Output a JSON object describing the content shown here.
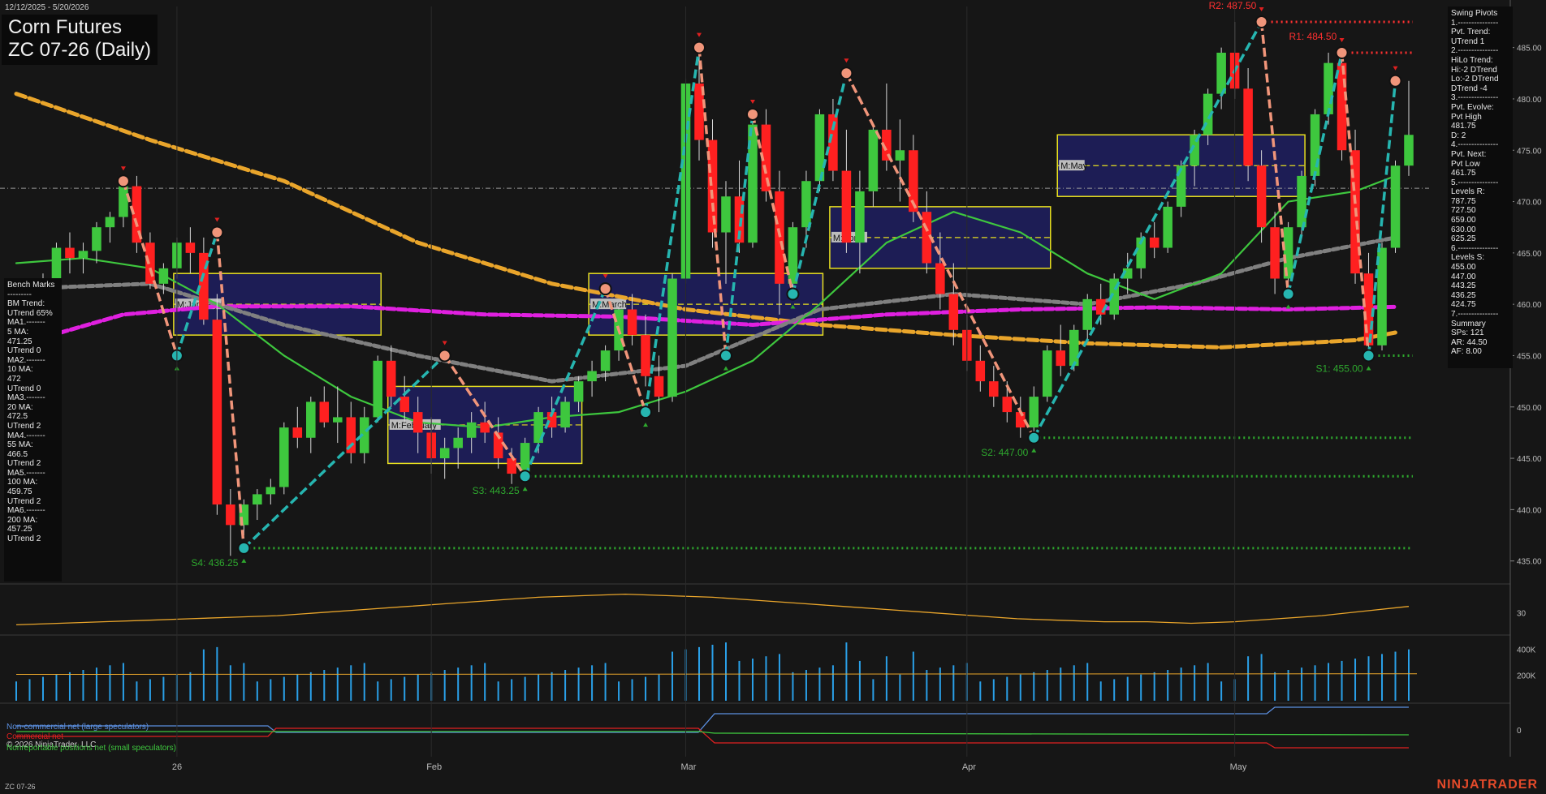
{
  "header": {
    "date_range": "12/12/2025 - 5/20/2026",
    "title_line1": "Corn Futures",
    "title_line2": "ZC 07-26 (Daily)"
  },
  "swing_panel_text": "Swing Pivots\n1.---------------\nPvt. Trend:\nUTrend 1\n2.---------------\nHiLo Trend:\nHi:-2 DTrend\nLo:-2 DTrend\nDTrend -4\n3.---------------\nPvt. Evolve:\nPvt High\n481.75\nD: 2\n4.---------------\nPvt. Next:\nPvt Low\n461.75\n5.---------------\nLevels R:\n787.75\n727.50\n659.00\n630.00\n625.25\n6.---------------\nLevels S:\n455.00\n447.00\n443.25\n436.25\n424.75\n7.---------------\nSummary\nSPs: 121\nAR: 44.50\nAF: 8.00",
  "bench_panel_text": "Bench Marks\n---------\nBM Trend:\nUTrend 65%\nMA1.-------\n5 MA:\n471.25\nUTrend 0\nMA2.-------\n10 MA:\n472\nUTrend 0\nMA3.-------\n20 MA:\n472.5\nUTrend 2\nMA4.-------\n55 MA:\n466.5\nUTrend 2\nMA5.-------\n100 MA:\n459.75\nUTrend 2\nMA6.-------\n200 MA:\n457.25\nUTrend 2",
  "cot_legend": {
    "noncommercial": "Non-commercial net (large speculators)",
    "commercial": "Commercial net",
    "copyright": "© 2026 NinjaTrader, LLC",
    "nonreportable": "Nonreportable positions net (small speculators)"
  },
  "footer": {
    "symbol": "ZC 07-26",
    "brand": "NINJATRADER"
  },
  "chart_data": {
    "type": "candlestick",
    "y_range": [
      433,
      489
    ],
    "y_ticks": [
      "435.00",
      "440.00",
      "445.00",
      "450.00",
      "455.00",
      "460.00",
      "465.00",
      "470.00",
      "475.00",
      "480.00",
      "485.00"
    ],
    "x_labels": [
      {
        "i": 12,
        "label": "26"
      },
      {
        "i": 31,
        "label": "Feb"
      },
      {
        "i": 50,
        "label": "Mar"
      },
      {
        "i": 71,
        "label": "Apr"
      },
      {
        "i": 91,
        "label": "May"
      }
    ],
    "candles": [
      [
        460.5,
        461,
        459,
        460.2
      ],
      [
        460.2,
        461,
        459.5,
        460.8
      ],
      [
        460.8,
        463,
        459.5,
        462
      ],
      [
        462,
        466,
        461,
        465.5
      ],
      [
        465.5,
        467,
        463,
        464.5
      ],
      [
        464.5,
        466,
        463,
        465.2
      ],
      [
        465.2,
        468,
        464,
        467.5
      ],
      [
        467.5,
        469,
        466,
        468.5
      ],
      [
        468.5,
        472,
        467.5,
        471.5
      ],
      [
        471.5,
        472.5,
        465,
        466
      ],
      [
        466,
        467,
        461.5,
        462
      ],
      [
        462,
        464,
        461,
        463.5
      ],
      [
        463.5,
        466.5,
        462.5,
        466
      ],
      [
        466,
        467.5,
        463,
        465
      ],
      [
        465,
        466.5,
        458,
        458.5
      ],
      [
        458.5,
        461,
        439.5,
        440.5
      ],
      [
        440.5,
        442,
        435.5,
        438.5
      ],
      [
        438.5,
        441,
        437.5,
        440.5
      ],
      [
        440.5,
        442,
        439,
        441.5
      ],
      [
        441.5,
        443,
        440.5,
        442.2
      ],
      [
        442.2,
        448.5,
        441.5,
        448
      ],
      [
        448,
        450,
        446,
        447
      ],
      [
        447,
        451,
        445.5,
        450.5
      ],
      [
        450.5,
        452,
        448,
        448.5
      ],
      [
        448.5,
        452,
        446.5,
        449
      ],
      [
        449,
        450.5,
        444.5,
        445.5
      ],
      [
        445.5,
        450,
        444.5,
        449
      ],
      [
        449,
        455,
        448.5,
        454.5
      ],
      [
        454.5,
        456,
        450,
        451
      ],
      [
        451,
        453,
        448.5,
        449.5
      ],
      [
        449.5,
        451,
        445.5,
        447.5
      ],
      [
        447.5,
        449,
        443.5,
        445
      ],
      [
        445,
        447,
        443,
        446
      ],
      [
        446,
        448,
        444,
        447
      ],
      [
        447,
        449.5,
        445.5,
        448.5
      ],
      [
        448.5,
        450.5,
        446.5,
        447.5
      ],
      [
        447.5,
        449,
        444,
        445
      ],
      [
        445,
        446,
        442.5,
        443.5
      ],
      [
        443.5,
        447,
        443,
        446.5
      ],
      [
        446.5,
        450,
        445.5,
        449.5
      ],
      [
        449.5,
        451,
        447,
        448
      ],
      [
        448,
        451,
        447.5,
        450.5
      ],
      [
        450.5,
        453,
        449.5,
        452.5
      ],
      [
        452.5,
        454.5,
        451,
        453.5
      ],
      [
        453.5,
        456,
        452.5,
        455.5
      ],
      [
        455.5,
        460,
        454.5,
        459.5
      ],
      [
        459.5,
        461,
        456,
        457
      ],
      [
        457,
        459,
        452,
        453
      ],
      [
        453,
        455,
        449.5,
        451
      ],
      [
        451,
        463,
        450.5,
        462.5
      ],
      [
        462.5,
        482,
        462,
        481.5
      ],
      [
        481.5,
        484.5,
        474,
        476
      ],
      [
        476,
        478,
        465.5,
        467
      ],
      [
        467,
        472,
        462,
        470.5
      ],
      [
        470.5,
        474,
        465,
        466
      ],
      [
        466,
        478.5,
        465.5,
        477.5
      ],
      [
        477.5,
        479,
        470,
        471
      ],
      [
        471,
        473,
        459,
        462
      ],
      [
        462,
        468,
        460.5,
        467.5
      ],
      [
        467.5,
        473,
        465.5,
        472
      ],
      [
        472,
        479,
        471,
        478.5
      ],
      [
        478.5,
        480,
        472,
        473
      ],
      [
        473,
        477,
        465,
        466
      ],
      [
        466,
        473,
        463,
        471
      ],
      [
        471,
        477.5,
        469.5,
        477
      ],
      [
        477,
        481.5,
        473,
        474
      ],
      [
        474,
        478,
        470,
        475
      ],
      [
        475,
        476.5,
        468,
        469
      ],
      [
        469,
        471,
        463,
        464
      ],
      [
        464,
        467,
        459.5,
        461
      ],
      [
        461,
        464,
        456,
        457.5
      ],
      [
        457.5,
        459,
        453.5,
        454.5
      ],
      [
        454.5,
        456,
        451.5,
        452.5
      ],
      [
        452.5,
        454,
        450,
        451
      ],
      [
        451,
        452.5,
        448.5,
        449.5
      ],
      [
        449.5,
        451,
        447,
        448
      ],
      [
        448,
        452,
        447.5,
        451
      ],
      [
        451,
        456,
        450.5,
        455.5
      ],
      [
        455.5,
        458,
        453,
        454
      ],
      [
        454,
        458,
        453.5,
        457.5
      ],
      [
        457.5,
        461,
        456.5,
        460.5
      ],
      [
        460.5,
        462,
        458,
        459
      ],
      [
        459,
        463,
        458.5,
        462.5
      ],
      [
        462.5,
        465,
        461,
        463.5
      ],
      [
        463.5,
        467,
        462.5,
        466.5
      ],
      [
        466.5,
        468,
        464.5,
        465.5
      ],
      [
        465.5,
        470,
        465,
        469.5
      ],
      [
        469.5,
        474,
        468.5,
        473.5
      ],
      [
        473.5,
        477,
        471.5,
        476.5
      ],
      [
        476.5,
        481,
        475.5,
        480.5
      ],
      [
        480.5,
        485,
        479,
        484.5
      ],
      [
        484.5,
        487.5,
        480,
        481
      ],
      [
        481,
        483,
        472,
        473.5
      ],
      [
        473.5,
        475,
        466,
        467.5
      ],
      [
        467.5,
        469,
        461,
        462.5
      ],
      [
        462.5,
        468,
        462,
        467.5
      ],
      [
        467.5,
        473,
        466.5,
        472.5
      ],
      [
        472.5,
        479,
        471.5,
        478.5
      ],
      [
        478.5,
        484.5,
        477.5,
        483.5
      ],
      [
        483.5,
        484,
        474,
        475
      ],
      [
        475,
        477,
        462,
        463
      ],
      [
        463,
        465,
        455,
        456
      ],
      [
        456,
        466,
        455.5,
        465.5
      ],
      [
        465.5,
        474,
        465,
        473.5
      ],
      [
        473.5,
        481.75,
        472.5,
        476.5
      ]
    ],
    "moving_averages": [
      {
        "name": "MA",
        "color": "#e9a52b",
        "dash": "12,5",
        "values": [
          [
            0,
            480.5
          ],
          [
            10,
            476
          ],
          [
            20,
            472
          ],
          [
            30,
            466
          ],
          [
            40,
            462
          ],
          [
            50,
            459.5
          ],
          [
            60,
            458
          ],
          [
            70,
            457
          ],
          [
            80,
            456.2
          ],
          [
            90,
            455.8
          ],
          [
            100,
            456.5
          ],
          [
            103,
            457.25
          ]
        ]
      },
      {
        "name": "MA",
        "color": "#e020e0",
        "dash": "10,4",
        "values": [
          [
            0,
            456
          ],
          [
            8,
            459
          ],
          [
            15,
            459.8
          ],
          [
            25,
            459.8
          ],
          [
            35,
            459
          ],
          [
            45,
            458.8
          ],
          [
            55,
            458
          ],
          [
            65,
            459
          ],
          [
            75,
            459.5
          ],
          [
            85,
            459.7
          ],
          [
            95,
            459.5
          ],
          [
            103,
            459.75
          ]
        ]
      },
      {
        "name": "MA",
        "color": "#808080",
        "dash": "7,4",
        "values": [
          [
            0,
            461.5
          ],
          [
            10,
            462
          ],
          [
            15,
            460
          ],
          [
            20,
            458
          ],
          [
            30,
            455
          ],
          [
            40,
            452.5
          ],
          [
            50,
            454
          ],
          [
            60,
            459.5
          ],
          [
            70,
            461
          ],
          [
            80,
            460
          ],
          [
            88,
            462
          ],
          [
            95,
            464.5
          ],
          [
            103,
            466.5
          ]
        ]
      },
      {
        "name": "MA",
        "color": "#3ec73e",
        "dash": "",
        "values": [
          [
            0,
            464
          ],
          [
            5,
            464.5
          ],
          [
            10,
            463.5
          ],
          [
            15,
            460
          ],
          [
            20,
            455
          ],
          [
            25,
            451
          ],
          [
            30,
            448.5
          ],
          [
            35,
            448
          ],
          [
            40,
            449
          ],
          [
            45,
            449.5
          ],
          [
            50,
            451.5
          ],
          [
            55,
            454.5
          ],
          [
            60,
            460
          ],
          [
            65,
            466
          ],
          [
            70,
            469
          ],
          [
            75,
            467
          ],
          [
            80,
            463
          ],
          [
            85,
            460.5
          ],
          [
            90,
            463
          ],
          [
            95,
            470
          ],
          [
            100,
            471
          ],
          [
            103,
            472.5
          ]
        ]
      }
    ],
    "swing_pivots": [
      {
        "i": 8,
        "value": 472
      },
      {
        "i": 12,
        "value": 455
      },
      {
        "i": 15,
        "value": 467
      },
      {
        "i": 17,
        "value": 436.25
      },
      {
        "i": 32,
        "value": 455
      },
      {
        "i": 38,
        "value": 443.25
      },
      {
        "i": 44,
        "value": 461.5
      },
      {
        "i": 47,
        "value": 449.5
      },
      {
        "i": 51,
        "value": 485
      },
      {
        "i": 53,
        "value": 455
      },
      {
        "i": 55,
        "value": 478.5
      },
      {
        "i": 58,
        "value": 461
      },
      {
        "i": 62,
        "value": 482.5
      },
      {
        "i": 76,
        "value": 447
      },
      {
        "i": 93,
        "value": 487.5
      },
      {
        "i": 95,
        "value": 461
      },
      {
        "i": 99,
        "value": 484.5
      },
      {
        "i": 101,
        "value": 455
      },
      {
        "i": 103,
        "value": 481.75
      }
    ],
    "monthly_boxes": [
      {
        "label": "M:January",
        "i0": 12,
        "i1": 27,
        "high": 463,
        "low": 457
      },
      {
        "label": "M:February",
        "i0": 28,
        "i1": 42,
        "high": 452,
        "low": 444.5
      },
      {
        "label": "M:March",
        "i0": 43,
        "i1": 60,
        "high": 463,
        "low": 457
      },
      {
        "label": "M:April",
        "i0": 61,
        "i1": 77,
        "high": 469.5,
        "low": 463.5
      },
      {
        "label": "M:May",
        "i0": 78,
        "i1": 96,
        "high": 476.5,
        "low": 470.5
      }
    ],
    "annotations": [
      {
        "text": "R2: 487.50",
        "value": 487.5,
        "color": "#ff3030"
      },
      {
        "text": "R1: 484.50",
        "value": 484.5,
        "color": "#ff3030"
      },
      {
        "text": "S1: 455.00",
        "value": 455,
        "color": "#2ea82e"
      },
      {
        "text": "S2: 447.00",
        "value": 447,
        "color": "#2ea82e"
      },
      {
        "text": "S3: 443.25",
        "value": 443.25,
        "color": "#2ea82e"
      },
      {
        "text": "S4: 436.25",
        "value": 436.25,
        "color": "#2ea82e"
      }
    ],
    "adx_panel": {
      "ticks": [
        "30"
      ],
      "values": [
        26,
        26.5,
        27,
        27.5,
        28,
        28.5,
        29,
        30,
        31,
        32,
        33,
        34,
        35,
        35.5,
        36,
        35.5,
        35,
        34,
        33,
        32,
        31,
        30,
        29,
        28,
        27.5,
        27,
        27,
        26.5,
        27,
        28,
        29,
        30.5,
        32
      ]
    },
    "volume_panel": {
      "ticks": [
        "400K",
        "200K"
      ]
    },
    "cot_panel": {
      "ticks": [
        "0"
      ]
    }
  }
}
